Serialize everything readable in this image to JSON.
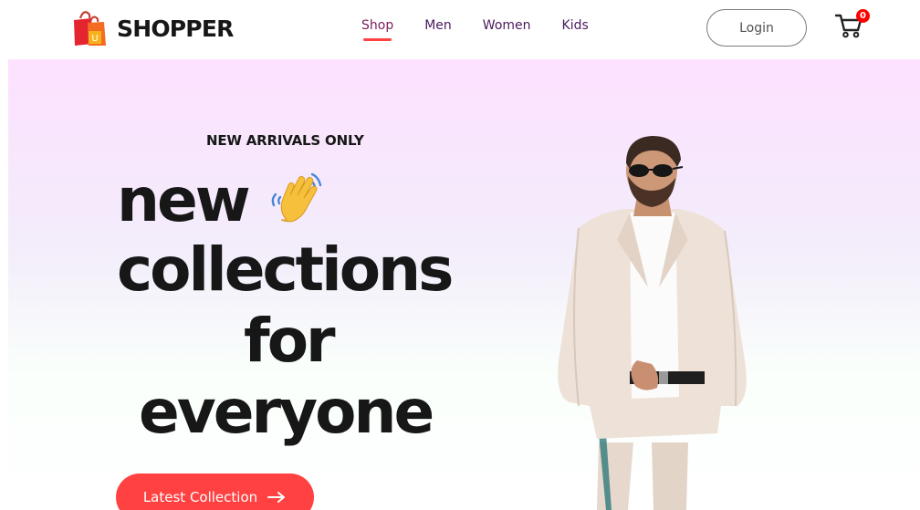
{
  "brand": {
    "name": "SHOPPER",
    "bag_letter": "U",
    "bag_colors": [
      "#f36c21",
      "#e4252f",
      "#f7b21b"
    ]
  },
  "nav": {
    "items": [
      {
        "label": "Shop",
        "active": true
      },
      {
        "label": "Men",
        "active": false
      },
      {
        "label": "Women",
        "active": false
      },
      {
        "label": "Kids",
        "active": false
      }
    ],
    "login_label": "Login",
    "cart_count": "0"
  },
  "hero": {
    "tag": "NEW ARRIVALS ONLY",
    "lines": [
      "new",
      "collections",
      "for",
      "everyone"
    ],
    "wave_icon": "waving-hand-icon",
    "cta_label": "Latest Collection",
    "cta_icon": "arrow-right-icon",
    "image": "male-model-beige-suit"
  },
  "colors": {
    "accent": "#ff4141",
    "nav_text": "#4a1a5c",
    "hero_gradient_top": "#fde1ff",
    "cart_badge": "#ff0000"
  }
}
